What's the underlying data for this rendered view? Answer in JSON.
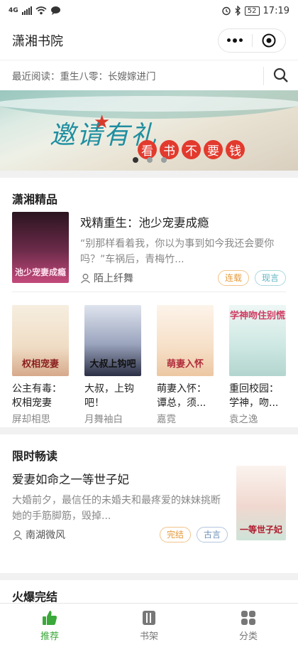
{
  "status": {
    "carrier": "4G",
    "battery": "52",
    "time": "17:19"
  },
  "app": {
    "title": "潇湘书院"
  },
  "recent": {
    "text": "最近阅读：重生八零：长嫂嫁进门"
  },
  "banner": {
    "title": "邀请有礼",
    "chars": [
      "看",
      "书",
      "不",
      "要",
      "钱"
    ]
  },
  "featured": {
    "section_title": "潇湘精品",
    "main_book": {
      "title": "戏精重生：池少宠妻成瘾",
      "desc": "“别那样看着我，你以为事到如今我还会要你吗？”车祸后，青梅竹...",
      "author": "陌上纤舞",
      "tags": [
        "连载",
        "现言"
      ],
      "cover_text": "池少宠妻成瘾",
      "cover_color": "#3b1e2b"
    },
    "grid": [
      {
        "title": "公主有毒：权相宠妻",
        "author": "屏却相思",
        "cover_text": "权相宠妻",
        "cover_color": "#f4e9d8"
      },
      {
        "title": "大叔，上钩吧！",
        "author": "月舞袖白",
        "cover_text": "大叔上钩吧",
        "cover_color": "#e8ecf3"
      },
      {
        "title": "萌妻入怀：谭总，须...",
        "author": "嘉霓",
        "cover_text": "萌妻入怀",
        "cover_color": "#fbf2e8"
      },
      {
        "title": "重回校园：学神，吻...",
        "author": "袁之逸",
        "cover_text": "学神吻住别慌",
        "cover_color": "#e7f3f1"
      }
    ]
  },
  "limited": {
    "section_title": "限时畅读",
    "book": {
      "title": "爱妻如命之一等世子妃",
      "desc": "大婚前夕，最信任的未婚夫和最疼爱的妹妹挑断她的手筋脚筋，毁掉...",
      "author": "南湖微风",
      "tags": [
        "完结",
        "古言"
      ],
      "cover_text": "一等世子妃",
      "cover_color": "#f5ece6"
    }
  },
  "next_section": {
    "title": "火爆完结"
  },
  "tabs": [
    {
      "label": "推荐",
      "active": true
    },
    {
      "label": "书架",
      "active": false
    },
    {
      "label": "分类",
      "active": false
    }
  ]
}
